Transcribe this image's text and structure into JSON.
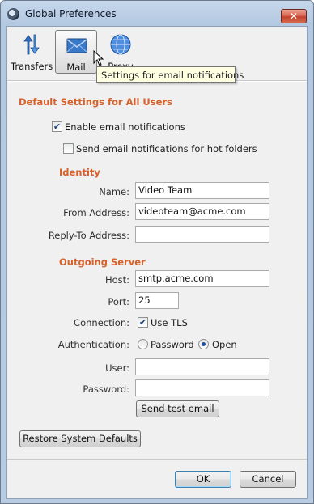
{
  "window": {
    "title": "Global Preferences",
    "close_glyph": "✕"
  },
  "toolbar": {
    "items": [
      {
        "label": "Transfers",
        "icon": "transfers-icon",
        "selected": false
      },
      {
        "label": "Mail",
        "icon": "mail-icon",
        "selected": true
      },
      {
        "label": "Proxy",
        "icon": "proxy-globe-icon",
        "selected": false
      }
    ],
    "tooltip": "Settings for email notifications"
  },
  "defaults": {
    "title": "Default Settings for All Users",
    "enable_email": {
      "label": "Enable email notifications",
      "checked": true
    },
    "hot_folders": {
      "label": "Send email notifications for hot folders",
      "checked": false
    }
  },
  "identity": {
    "title": "Identity",
    "name": {
      "label": "Name:",
      "value": "Video Team"
    },
    "from": {
      "label": "From Address:",
      "value": "videoteam@acme.com"
    },
    "reply_to": {
      "label": "Reply-To Address:",
      "value": ""
    }
  },
  "server": {
    "title": "Outgoing Server",
    "host": {
      "label": "Host:",
      "value": "smtp.acme.com"
    },
    "port": {
      "label": "Port:",
      "value": "25"
    },
    "connection": {
      "label": "Connection:",
      "option": "Use TLS",
      "checked": true
    },
    "authentication": {
      "label": "Authentication:",
      "options": [
        "Password",
        "Open"
      ],
      "selected": "Open"
    },
    "user": {
      "label": "User:",
      "value": ""
    },
    "password": {
      "label": "Password:",
      "value": ""
    },
    "test_button": "Send test email"
  },
  "restore_button": "Restore System Defaults",
  "dialog_buttons": {
    "ok": "OK",
    "cancel": "Cancel"
  },
  "colors": {
    "section_title": "#d8612a",
    "accent_checkmark": "#21427b"
  }
}
